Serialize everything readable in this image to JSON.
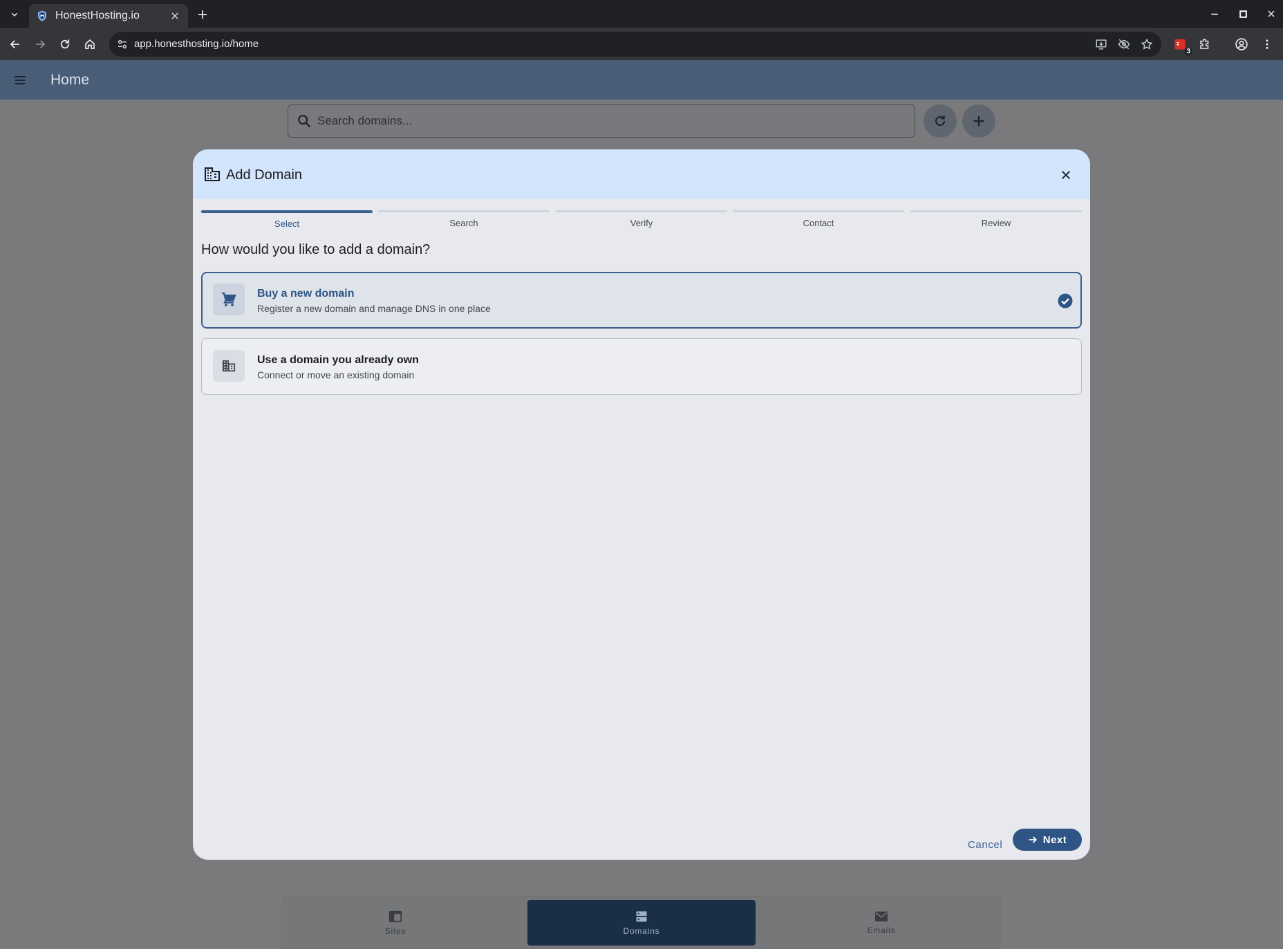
{
  "browser": {
    "tab_title": "HonestHosting.io",
    "url": "app.honesthosting.io/home",
    "extension_badge": "3"
  },
  "app": {
    "title": "Home",
    "search_placeholder": "Search domains..."
  },
  "dialog": {
    "title": "Add Domain",
    "steps": [
      {
        "label": "Select",
        "active": true
      },
      {
        "label": "Search",
        "active": false
      },
      {
        "label": "Verify",
        "active": false
      },
      {
        "label": "Contact",
        "active": false
      },
      {
        "label": "Review",
        "active": false
      }
    ],
    "question": "How would you like to add a domain?",
    "options": [
      {
        "title": "Buy a new domain",
        "subtitle": "Register a new domain and manage DNS in one place",
        "selected": true,
        "icon": "cart-icon"
      },
      {
        "title": "Use a domain you already own",
        "subtitle": "Connect or move an existing domain",
        "selected": false,
        "icon": "building-icon"
      }
    ],
    "cancel_label": "Cancel",
    "next_label": "Next"
  },
  "bottom_nav": [
    {
      "label": "Sites",
      "icon": "web-icon",
      "active": false
    },
    {
      "label": "Domains",
      "icon": "dns-icon",
      "active": true
    },
    {
      "label": "Emails",
      "icon": "mail-icon",
      "active": false
    }
  ],
  "colors": {
    "primary": "#2f5586",
    "dialog_header": "#d3e4fd",
    "app_header": "#4a5d76"
  }
}
